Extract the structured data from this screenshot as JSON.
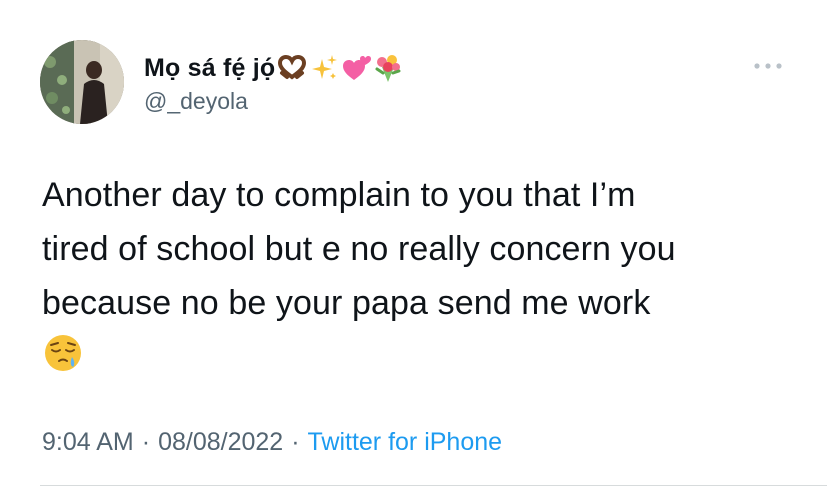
{
  "author": {
    "display_name": "Mọ sá fẹ́ jọ́",
    "handle": "@_deyola",
    "name_emojis": [
      "heart-hands-emoji",
      "sparkles-emoji",
      "two-hearts-emoji",
      "bouquet-emoji"
    ]
  },
  "tweet": {
    "text_lines": [
      "Another day to complain to you that I’m",
      "tired of school but e no really concern you",
      "because no be your papa send me work"
    ],
    "trailing_emoji": "sleepy-face-emoji"
  },
  "meta": {
    "time": "9:04 AM",
    "separator": "·",
    "date": "08/08/2022",
    "source": "Twitter for iPhone"
  },
  "colors": {
    "text": "#0f1419",
    "secondary": "#536471",
    "link": "#1d9bf0",
    "divider": "#d7dbdc"
  }
}
